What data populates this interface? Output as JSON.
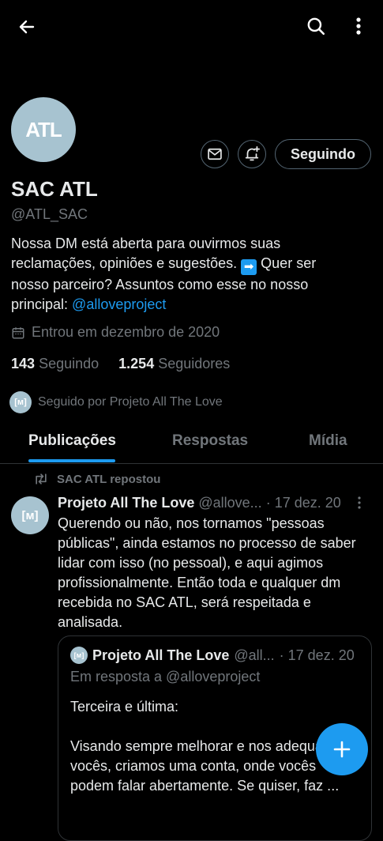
{
  "topbar": {
    "back_icon": "arrow-left-icon",
    "search_icon": "search-icon",
    "more_icon": "more-vertical-icon"
  },
  "profile": {
    "avatar_text": "ATL",
    "name": "SAC ATL",
    "handle": "@ATL_SAC",
    "follow_button": "Seguindo",
    "bio_part1": "Nossa DM está aberta para ouvirmos suas reclamações, opiniões e sugestões. ",
    "bio_arrow": "➡",
    "bio_part2": " Quer ser nosso parceiro? Assuntos como esse no nosso principal: ",
    "bio_link": "@alloveproject",
    "joined": "Entrou em dezembro de 2020",
    "following_count": "143",
    "following_label": "Seguindo",
    "followers_count": "1.254",
    "followers_label": "Seguidores",
    "followed_by": "Seguido por Projeto All The Love"
  },
  "tabs": [
    {
      "label": "Publicações",
      "active": true
    },
    {
      "label": "Respostas",
      "active": false
    },
    {
      "label": "Mídia",
      "active": false
    }
  ],
  "post": {
    "repost_label": "SAC ATL repostou",
    "author_name": "Projeto All The Love",
    "author_handle": "@allove...",
    "date": "· 17 dez. 20",
    "text": "Querendo ou não, nos tornamos \"pessoas públicas\", ainda estamos no processo de saber lidar com isso (no pessoal), e aqui agimos profissionalmente. Então toda e qualquer dm recebida no SAC ATL, será respeitada e analisada.",
    "quote": {
      "author_name": "Projeto All The Love",
      "author_handle": "@all...",
      "date": "· 17 dez. 20",
      "reply_to": "Em resposta a @alloveproject",
      "line1": "Terceira e última:",
      "line2": "Visando sempre melhorar e nos adequar a vocês, criamos uma conta, onde vocês podem falar abertamente. Se quiser, faz ..."
    }
  },
  "colors": {
    "accent": "#1d9bf0",
    "background": "#000000",
    "muted": "#71767b",
    "avatar": "#a7c3d0"
  }
}
